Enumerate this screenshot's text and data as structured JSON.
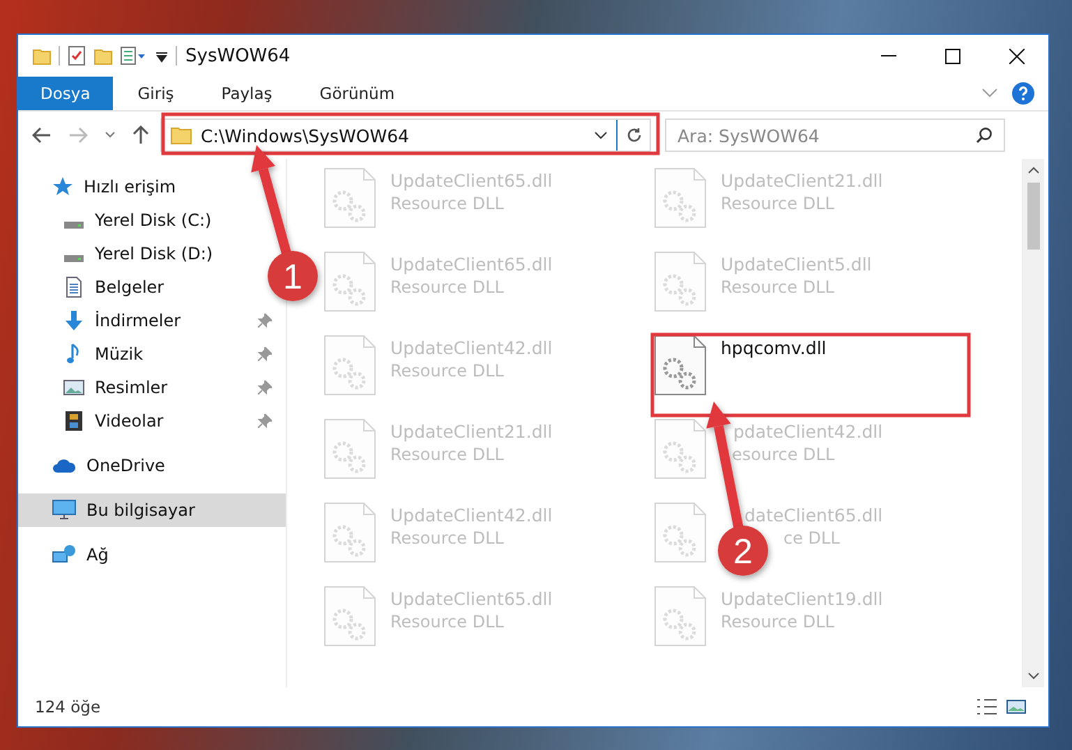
{
  "window": {
    "title": "SysWOW64"
  },
  "ribbon_tabs": [
    {
      "label": "Dosya",
      "selected": true
    },
    {
      "label": "Giriş",
      "selected": false
    },
    {
      "label": "Paylaş",
      "selected": false
    },
    {
      "label": "Görünüm",
      "selected": false
    }
  ],
  "address_bar": {
    "path": "C:\\Windows\\SysWOW64"
  },
  "search": {
    "placeholder": "Ara: SysWOW64"
  },
  "sidebar": {
    "items": [
      {
        "label": "Hızlı erişim",
        "selected": false,
        "children": [
          {
            "label": "Yerel Disk (C:)",
            "selected": false
          },
          {
            "label": "Yerel Disk (D:)",
            "selected": false
          },
          {
            "label": "Belgeler",
            "selected": false
          },
          {
            "label": "İndirmeler",
            "pinned": true,
            "selected": false
          },
          {
            "label": "Müzik",
            "pinned": true,
            "selected": false
          },
          {
            "label": "Resimler",
            "pinned": true,
            "selected": false
          },
          {
            "label": "Videolar",
            "pinned": true,
            "selected": false
          }
        ]
      },
      {
        "label": "OneDrive",
        "selected": false
      },
      {
        "label": "Bu bilgisayar",
        "selected": true
      },
      {
        "label": "Ağ",
        "selected": false
      }
    ]
  },
  "files": [
    {
      "name": "UpdateClient65.dll",
      "type": "Resource DLL",
      "blurred": true
    },
    {
      "name": "UpdateClient21.dll",
      "type": "Resource DLL",
      "blurred": true
    },
    {
      "name": "UpdateClient65.dll",
      "type": "Resource DLL",
      "blurred": true
    },
    {
      "name": "UpdateClient5.dll",
      "type": "Resource DLL",
      "blurred": true
    },
    {
      "name": "UpdateClient42.dll",
      "type": "Resource DLL",
      "blurred": true
    },
    {
      "name": "hpqcomv.dll",
      "blurred": false
    },
    {
      "name": "UpdateClient21.dll",
      "type": "Resource DLL",
      "blurred": true
    },
    {
      "name": "pdateClient42.dll",
      "type": "esource DLL",
      "blurred": true
    },
    {
      "name": "UpdateClient42.dll",
      "type": "Resource DLL",
      "blurred": true
    },
    {
      "name": "dateClient65.dll",
      "type": "ce DLL",
      "blurred": true
    },
    {
      "name": "UpdateClient65.dll",
      "type": "Resource DLL",
      "blurred": true
    },
    {
      "name": "UpdateClient19.dll",
      "type": "Resource DLL",
      "blurred": true
    }
  ],
  "status_bar": {
    "item_count": "124 öğe"
  },
  "annotations": [
    {
      "number": "1"
    },
    {
      "number": "2"
    }
  ]
}
